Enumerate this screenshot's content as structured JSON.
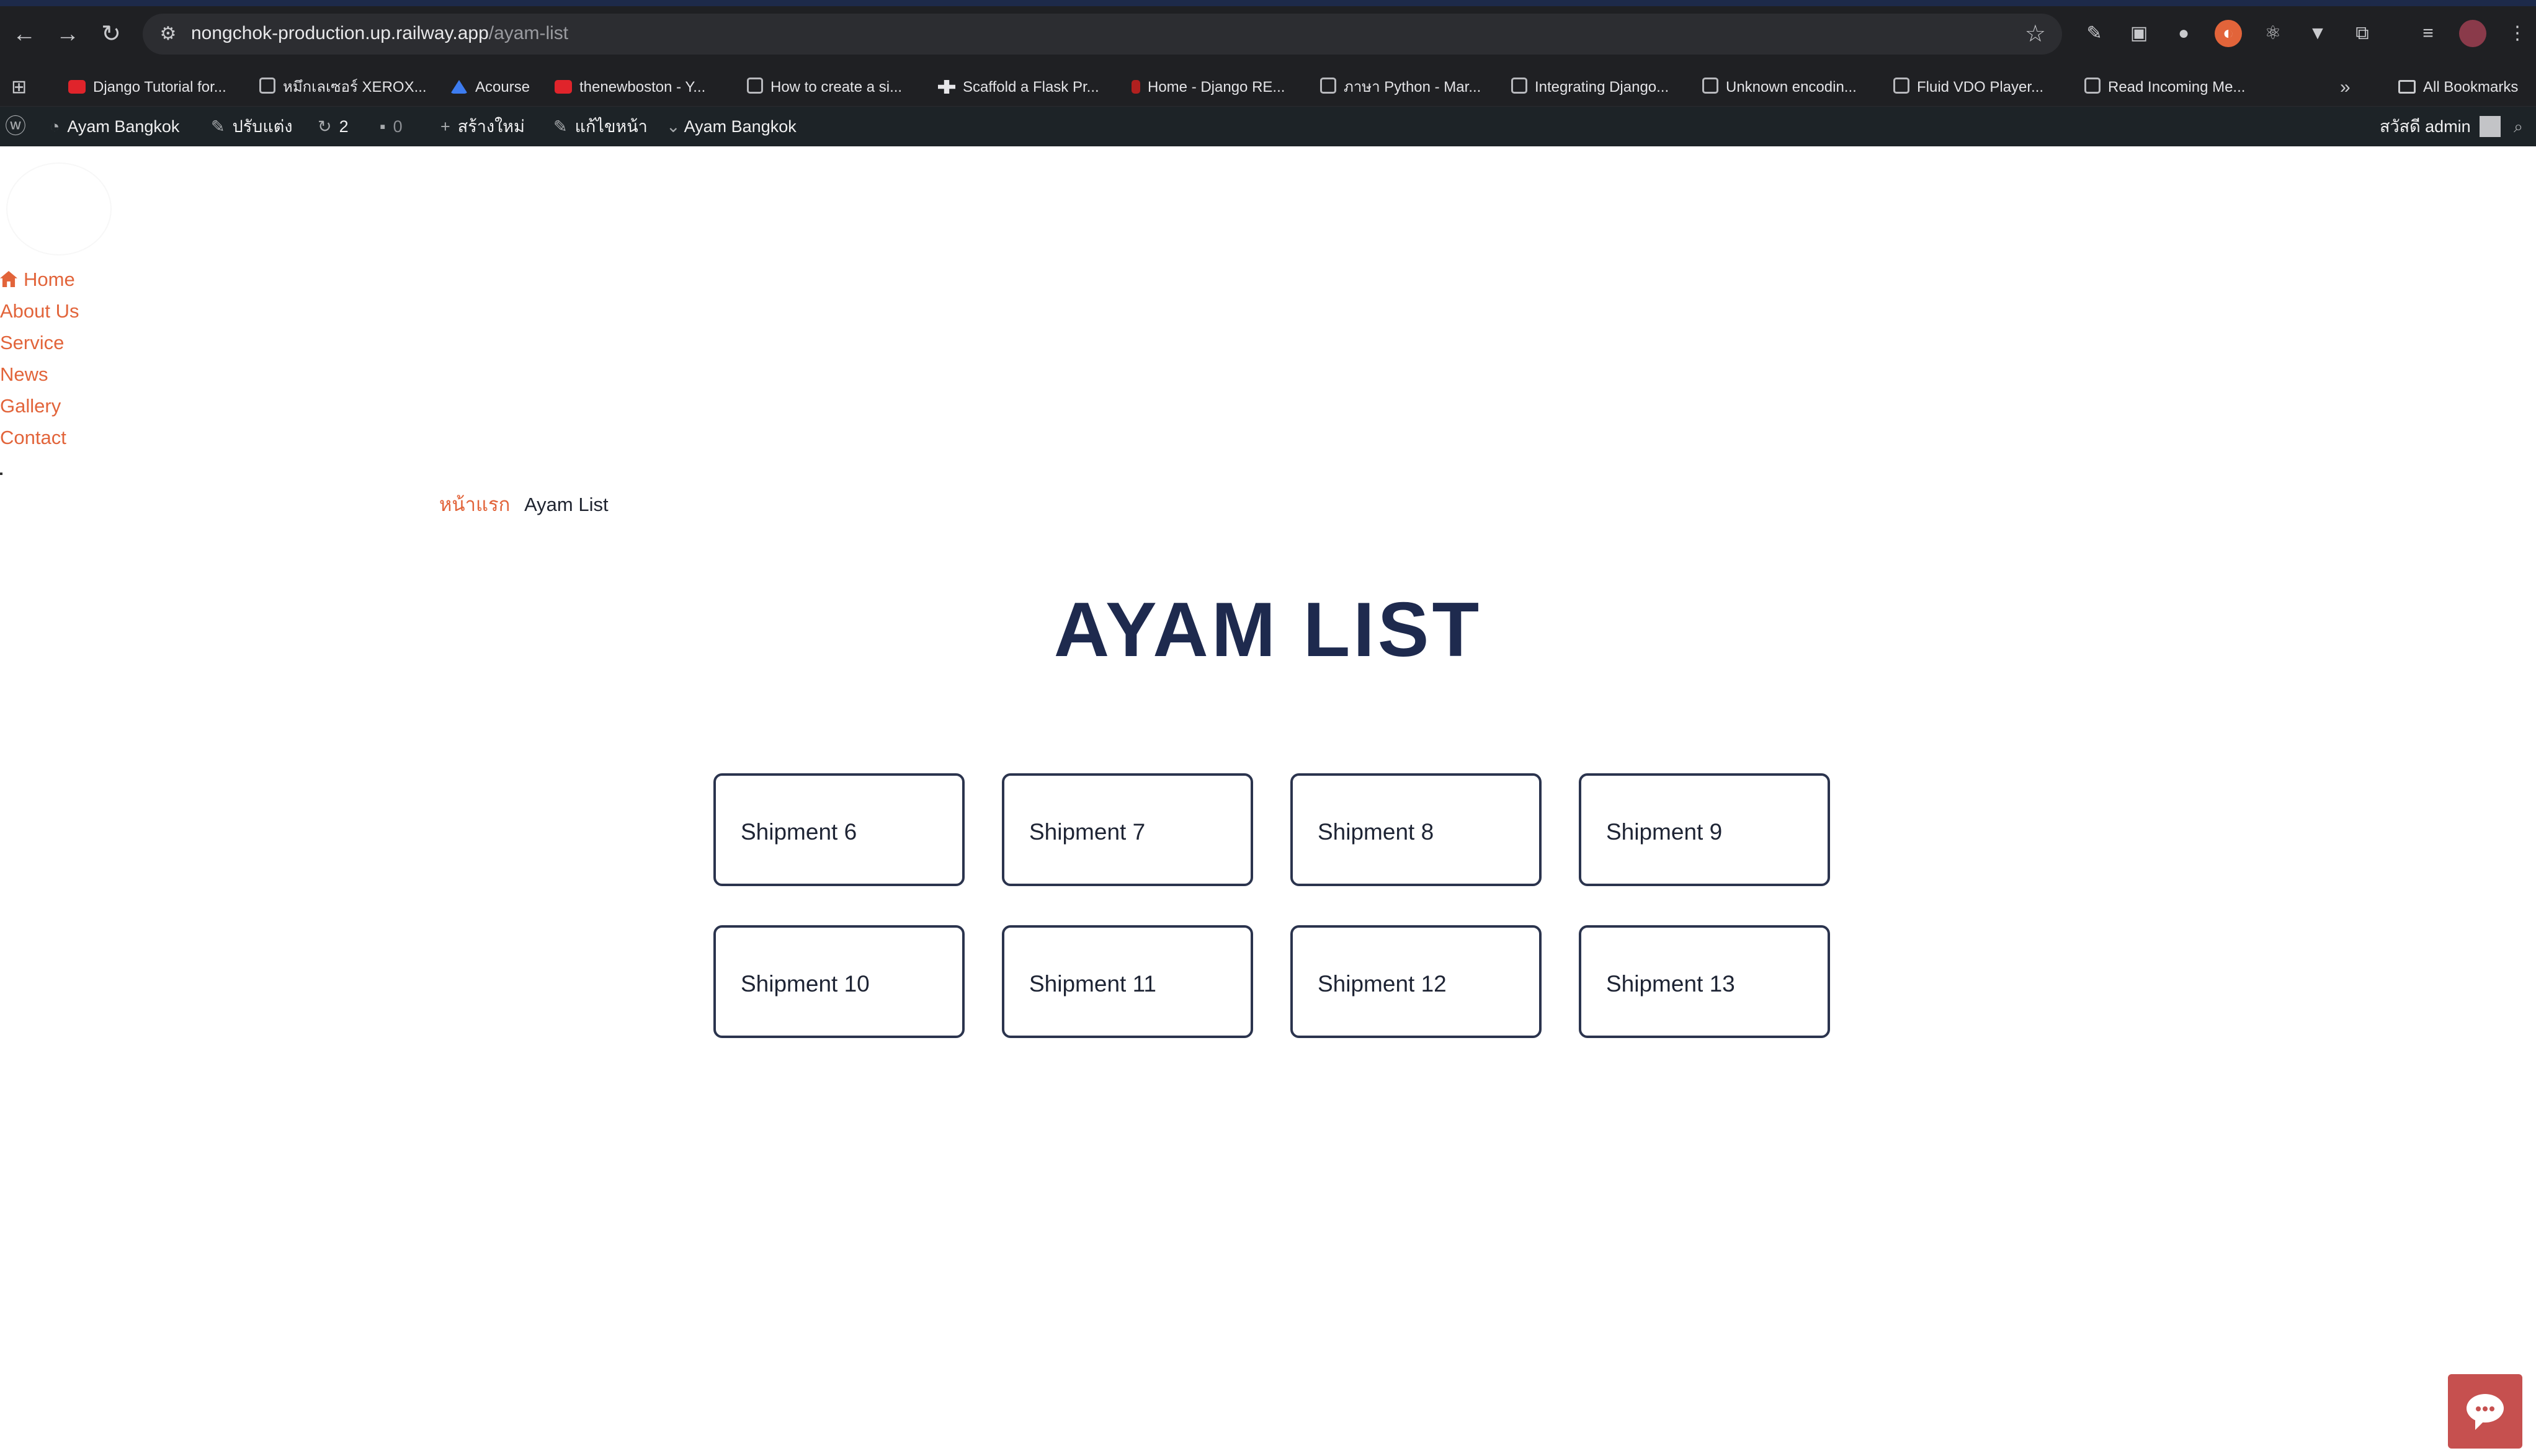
{
  "browser": {
    "url_host": "nongchok-production.up.railway.app",
    "url_path": "/ayam-list",
    "bookmarks": [
      {
        "label": "Django Tutorial for...",
        "icon": "youtube-icon"
      },
      {
        "label": "หมึกเลเซอร์ XEROX...",
        "icon": "globe-icon"
      },
      {
        "label": "Acourse",
        "icon": "acourse-icon"
      },
      {
        "label": "thenewboston - Y...",
        "icon": "youtube-icon"
      },
      {
        "label": "How to create a si...",
        "icon": "globe-icon"
      },
      {
        "label": "Scaffold a Flask Pr...",
        "icon": "puzzle-icon"
      },
      {
        "label": "Home - Django RE...",
        "icon": "bookmark-icon"
      },
      {
        "label": "ภาษา Python - Mar...",
        "icon": "globe-icon"
      },
      {
        "label": "Integrating Django...",
        "icon": "globe-icon"
      },
      {
        "label": "Unknown encodin...",
        "icon": "globe-icon"
      },
      {
        "label": "Fluid VDO Player...",
        "icon": "globe-icon"
      },
      {
        "label": "Read Incoming Me...",
        "icon": "globe-icon"
      }
    ],
    "all_bookmarks": "All Bookmarks"
  },
  "adminbar": {
    "site_name": "Ayam Bangkok",
    "customize": "ปรับแต่ง",
    "updates_count": "2",
    "comments_count": "0",
    "new": "สร้างใหม่",
    "edit_page": "แก้ไขหน้า",
    "plugin_label": "Ayam Bangkok",
    "greeting": "สวัสดี admin"
  },
  "nav": {
    "home": "Home",
    "about": "About Us",
    "service": "Service",
    "news": "News",
    "gallery": "Gallery",
    "contact": "Contact"
  },
  "breadcrumb": {
    "home": "หน้าแรก",
    "current": "Ayam List"
  },
  "page": {
    "title": "AYAM LIST"
  },
  "shipments": [
    "Shipment 6",
    "Shipment 7",
    "Shipment 8",
    "Shipment 9",
    "Shipment 10",
    "Shipment 11",
    "Shipment 12",
    "Shipment 13"
  ],
  "colors": {
    "accent": "#e2643a",
    "title": "#1e2a4e",
    "card_border": "#2b344e",
    "chat": "#c6504f"
  }
}
